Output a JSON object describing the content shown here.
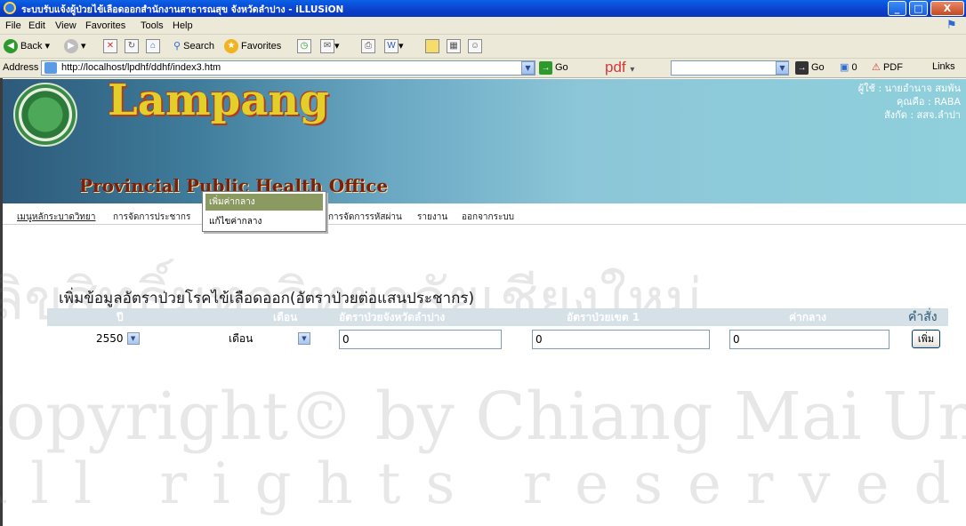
{
  "window": {
    "title": "ระบบรับแจ้งผู้ป่วยไข้เลือดออกสำนักงานสาธารณสุข จังหวัดลำปาง - iLLUSiON",
    "min": "_",
    "max": "□",
    "close": "X"
  },
  "menu": [
    "File",
    "Edit",
    "View",
    "Favorites",
    "Tools",
    "Help"
  ],
  "toolbar": {
    "back": "Back",
    "search": "Search",
    "favorites": "Favorites"
  },
  "address": {
    "label": "Address",
    "url": "http://localhost/lpdhf/ddhf/index3.htm",
    "go": "Go",
    "pdf_logo": "pdf",
    "go2": "Go",
    "count": "0",
    "pdf_label": "PDF",
    "links": "Links"
  },
  "banner": {
    "brand": "Lampang",
    "subtitle": "Provincial Public Health Office",
    "user_lines": [
      "ผู้ใช้ : นายอำนาจ สมพัน",
      "คุณคือ : RABA",
      "สังกัด : สสจ.ลำปา"
    ]
  },
  "nav": {
    "items": [
      "เมนูหลักระบาดวิทยา",
      "การจัดการประชากร",
      "การจัดการรหัสผ่าน",
      "รายงาน",
      "ออกจากระบบ"
    ],
    "dropdown": [
      "เพิ่มค่ากลาง",
      "แก้ไขค่ากลาง"
    ]
  },
  "form": {
    "title": "เพิ่มข้อมูลอัตราป่วยโรคไข้เลือดออก(อัตราป่วยต่อแสนประชากร)",
    "headers": [
      "ปี",
      "เดือน",
      "อัตราป่วยจังหวัดลำปาง",
      "อัตราป่วยเขต 1",
      "ค่ากลาง",
      "คำสั่ง"
    ],
    "year": "2550",
    "month": "เดือน",
    "province_rate": "0",
    "region_rate": "0",
    "median": "0",
    "add_button": "เพิ่ม"
  },
  "watermark": {
    "line1": "ลิขสิทธิ์มหาวิทยาลัยเชียงใหม่",
    "line2": "Copyright© by Chiang Mai University",
    "line3": "All rights reserved"
  }
}
